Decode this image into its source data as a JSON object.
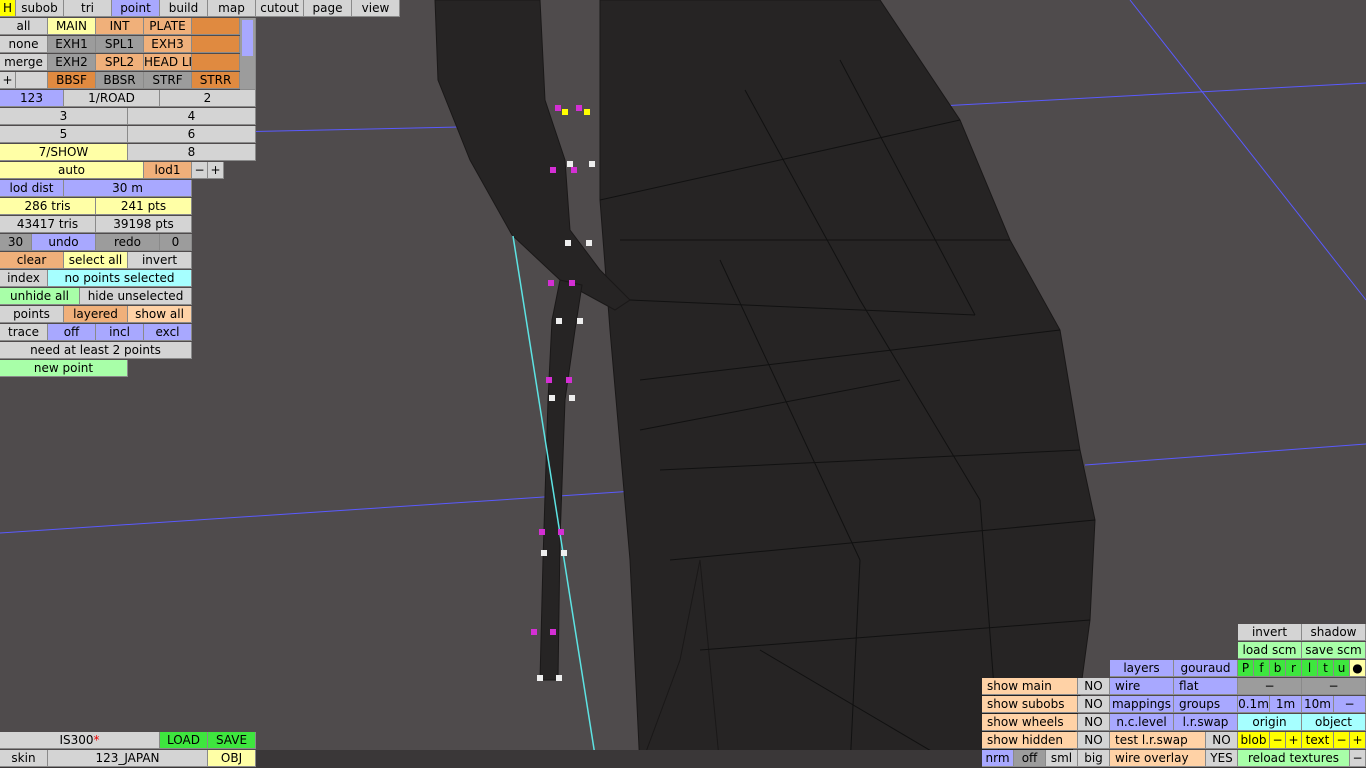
{
  "menu": {
    "h": "H",
    "subob": "subob",
    "tri": "tri",
    "point": "point",
    "build": "build",
    "map": "map",
    "cutout": "cutout",
    "page": "page",
    "view": "view"
  },
  "groups": {
    "all": "all",
    "main": "MAIN",
    "int": "INT",
    "plate": "PLATE",
    "none": "none",
    "exh1": "EXH1",
    "spl1": "SPL1",
    "exh3": "EXH3",
    "merge": "merge",
    "exh2": "EXH2",
    "spl2": "SPL2",
    "headli": "HEAD LI",
    "plus": "+",
    "bbsf": "BBSF",
    "bbsr": "BBSR",
    "strf": "STRF",
    "strr": "STRR"
  },
  "lod": {
    "l123": "123",
    "road": "1/ROAD",
    "l2": "2",
    "l3": "3",
    "l4": "4",
    "l5": "5",
    "l6": "6",
    "show": "7/SHOW",
    "l8": "8",
    "auto": "auto",
    "lod1": "lod1",
    "minus": "−",
    "plus": "+",
    "dist_label": "lod dist",
    "dist_val": "30 m"
  },
  "stats": {
    "tris": "286 tris",
    "pts": "241 pts",
    "total_tris": "43417 tris",
    "total_pts": "39198 pts"
  },
  "undo": {
    "count": "30",
    "undo": "undo",
    "redo": "redo",
    "redo_count": "0"
  },
  "select": {
    "clear": "clear",
    "all": "select all",
    "invert": "invert",
    "index": "index",
    "status": "no points selected"
  },
  "hide": {
    "unhide": "unhide all",
    "hide_unsel": "hide unselected"
  },
  "display": {
    "points": "points",
    "layered": "layered",
    "show_all": "show all"
  },
  "trace": {
    "label": "trace",
    "off": "off",
    "incl": "incl",
    "excl": "excl",
    "message": "need at least 2 points"
  },
  "new_point": "new point",
  "file": {
    "name": "IS300",
    "modified": "*",
    "load": "LOAD",
    "save": "SAVE",
    "skin_label": "skin",
    "skin_val": "123_JAPAN",
    "obj": "OBJ"
  },
  "right": {
    "invert": "invert",
    "shadow": "shadow",
    "load_scm": "load scm",
    "save_scm": "save scm",
    "flags": [
      "P",
      "f",
      "b",
      "r",
      "l",
      "t",
      "u",
      "●"
    ],
    "layers": "layers",
    "gouraud": "gouraud",
    "wire": "wire",
    "flat": "flat",
    "mappings": "mappings",
    "groups": "groups",
    "m01": "0.1m",
    "m1": "1m",
    "m10": "10m",
    "minus": "−",
    "nclevel": "n.c.level",
    "lrswap": "l.r.swap",
    "origin": "origin",
    "object": "object",
    "test_lrswap": "test l.r.swap",
    "no": "NO",
    "blob": "blob",
    "text": "text",
    "plus": "+",
    "wire_overlay": "wire overlay",
    "yes": "YES",
    "reload": "reload textures",
    "nrm": "nrm",
    "off": "off",
    "sml": "sml",
    "big": "big"
  },
  "show_panel": {
    "main": "show main",
    "subobs": "show subobs",
    "wheels": "show wheels",
    "hidden": "show hidden",
    "no": "NO"
  },
  "colors": {
    "background": "#4f4b4c",
    "mesh": "#262424",
    "selected_vertex": "#d42fd4",
    "vertex": "#eeeeee",
    "highlight_vertex": "#ffff00",
    "grid": "#5a5aff",
    "guide": "#5de3e3"
  }
}
